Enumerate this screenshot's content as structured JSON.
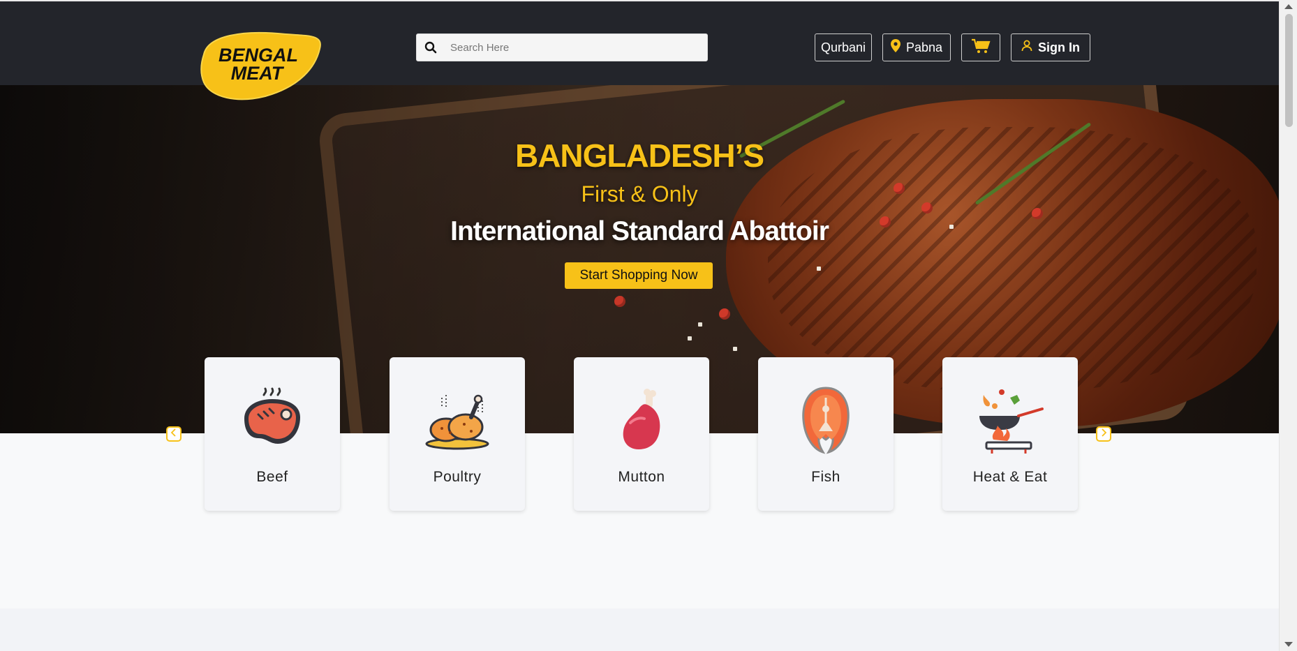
{
  "header": {
    "logo_text_line1": "BENGAL",
    "logo_text_line2": "MEAT",
    "search_placeholder": "Search Here",
    "buttons": {
      "qurbani": "Qurbani",
      "location": "Pabna",
      "sign_in": "Sign In"
    },
    "icons": {
      "search": "search-icon",
      "location": "map-pin-icon",
      "cart": "cart-icon",
      "user": "user-icon"
    }
  },
  "hero": {
    "line1": "BANGLADESH’S",
    "line2": "First & Only",
    "line3": "International Standard Abattoir",
    "cta": "Start Shopping Now"
  },
  "categories": [
    {
      "label": "Beef",
      "icon": "beef-steak-icon"
    },
    {
      "label": "Poultry",
      "icon": "roast-chicken-icon"
    },
    {
      "label": "Mutton",
      "icon": "mutton-leg-icon"
    },
    {
      "label": "Fish",
      "icon": "fish-steak-icon"
    },
    {
      "label": "Heat & Eat",
      "icon": "cooking-pan-icon"
    }
  ],
  "colors": {
    "header_bg": "#23252b",
    "accent": "#f7c118",
    "page_bg": "#f8f9fa"
  }
}
